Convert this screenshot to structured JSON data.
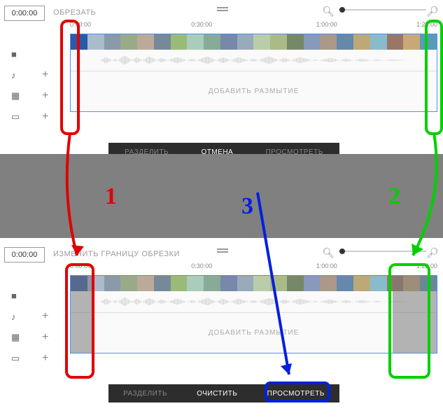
{
  "top": {
    "time": "0:00:00",
    "mode": "ОБРЕЗАТЬ",
    "ruler": {
      "t0": "0:00:00",
      "t1": "0:30:00",
      "t2": "1:00:00",
      "t3": "1:28:00"
    },
    "blur": "ДОБАВИТЬ РАЗМЫТИЕ",
    "actions": {
      "split": "РАЗДЕЛИТЬ",
      "cancel": "ОТМЕНА",
      "preview": "ПРОСМОТРЕТЬ"
    }
  },
  "bottom": {
    "time": "0:00:00",
    "mode": "ИЗМЕНИТЬ ГРАНИЦУ ОБРЕЗКИ",
    "ruler": {
      "t0": "0:00:00",
      "t1": "0:30:00",
      "t2": "1:00:00",
      "t3": "1:28:00"
    },
    "blur": "ДОБАВИТЬ РАЗМЫТИЕ",
    "actions": {
      "split": "РАЗДЕЛИТЬ",
      "clear": "ОЧИСТИТЬ",
      "preview": "ПРОСМОТРЕТЬ"
    }
  },
  "annot": {
    "n1": "1",
    "n2": "2",
    "n3": "3"
  },
  "colors": {
    "red": "#e00000",
    "green": "#00d000",
    "blue": "#0020e0"
  }
}
